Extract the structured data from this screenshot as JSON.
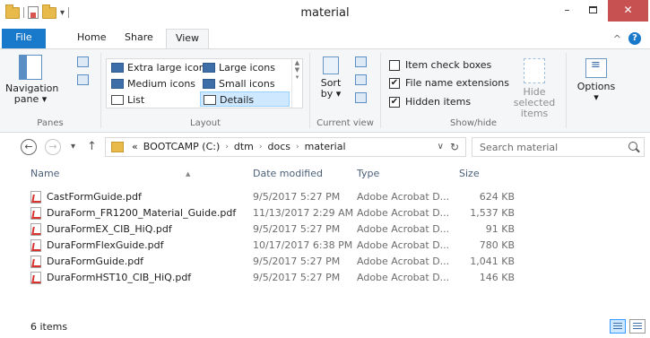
{
  "window": {
    "title": "material",
    "minimize": "–",
    "close": "✕"
  },
  "tabs": {
    "file": "File",
    "home": "Home",
    "share": "Share",
    "view": "View"
  },
  "ribbon": {
    "panes": {
      "navigation_pane": "Navigation",
      "navigation_pane_line2": "pane ▾",
      "group_label": "Panes"
    },
    "layout": {
      "items": [
        "Extra large icons",
        "Large icons",
        "Medium icons",
        "Small icons",
        "List",
        "Details"
      ],
      "selected": "Details",
      "group_label": "Layout"
    },
    "current_view": {
      "sort_by": "Sort",
      "sort_by_line2": "by ▾",
      "group_label": "Current view"
    },
    "show_hide": {
      "item_check_boxes": "Item check boxes",
      "item_check_boxes_checked": false,
      "file_name_extensions": "File name extensions",
      "file_name_extensions_checked": true,
      "hidden_items": "Hidden items",
      "hidden_items_checked": true,
      "hide_selected": "Hide selected",
      "hide_selected_line2": "items",
      "group_label": "Show/hide"
    },
    "options": {
      "label": "Options",
      "caret": "▾"
    }
  },
  "address": {
    "overflow": "«",
    "crumbs": [
      "BOOTCAMP (C:)",
      "dtm",
      "docs",
      "material"
    ],
    "search_placeholder": "Search material"
  },
  "columns": {
    "name": "Name",
    "date": "Date modified",
    "type": "Type",
    "size": "Size"
  },
  "files": [
    {
      "name": "CastFormGuide.pdf",
      "date": "9/5/2017 5:27 PM",
      "type": "Adobe Acrobat D...",
      "size": "624 KB"
    },
    {
      "name": "DuraForm_FR1200_Material_Guide.pdf",
      "date": "11/13/2017 2:29 AM",
      "type": "Adobe Acrobat D...",
      "size": "1,537 KB"
    },
    {
      "name": "DuraFormEX_CIB_HiQ.pdf",
      "date": "9/5/2017 5:27 PM",
      "type": "Adobe Acrobat D...",
      "size": "91 KB"
    },
    {
      "name": "DuraFormFlexGuide.pdf",
      "date": "10/17/2017 6:38 PM",
      "type": "Adobe Acrobat D...",
      "size": "780 KB"
    },
    {
      "name": "DuraFormGuide.pdf",
      "date": "9/5/2017 5:27 PM",
      "type": "Adobe Acrobat D...",
      "size": "1,041 KB"
    },
    {
      "name": "DuraFormHST10_CIB_HiQ.pdf",
      "date": "9/5/2017 5:27 PM",
      "type": "Adobe Acrobat D...",
      "size": "146 KB"
    }
  ],
  "status": {
    "count": "6 items"
  },
  "colors": {
    "file_tab": "#1979ca",
    "selected_bg": "#cde8ff",
    "close_button": "#c75050"
  }
}
